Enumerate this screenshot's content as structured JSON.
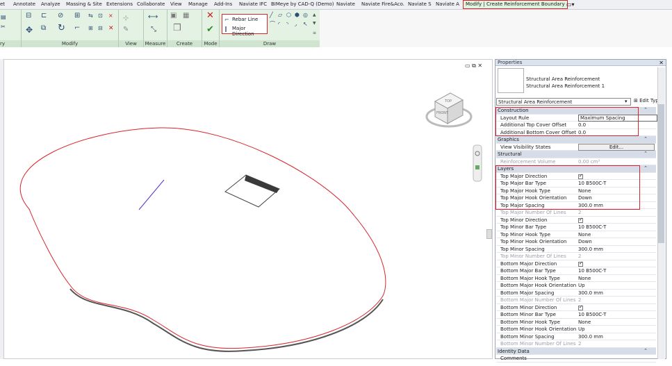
{
  "menu": {
    "tabs": [
      "et",
      "Annotate",
      "Analyze",
      "Massing & Site",
      "Extensions",
      "Collaborate",
      "View",
      "Manage",
      "Add-Ins",
      "Naviate IFC",
      "BIMeye by CAD-Q (Demo)",
      "Naviate",
      "Naviate Fire&Aco.",
      "Naviate S",
      "Naviate A"
    ],
    "active_tab": "Modify | Create Reinforcement Boundary"
  },
  "ribbon": {
    "groups": [
      "ry",
      "Modify",
      "View",
      "Measure",
      "Create",
      "Mode",
      "Draw"
    ],
    "draw_options": [
      "Rebar Line",
      "Major Direction"
    ]
  },
  "properties": {
    "title": "Properties",
    "type_name_1": "Structural Area Reinforcement",
    "type_name_2": "Structural Area Reinforcement 1",
    "selector": "Structural Area Reinforcement",
    "edit_type": "Edit Type",
    "rows": [
      {
        "kind": "sec",
        "label": "Construction"
      },
      {
        "label": "Layout Rule",
        "value": "Maximum Spacing",
        "box": true
      },
      {
        "label": "Additional Top Cover Offset",
        "value": "0.0"
      },
      {
        "label": "Additional Bottom Cover Offset",
        "value": "0.0"
      },
      {
        "kind": "sec",
        "label": "Graphics"
      },
      {
        "label": "View Visibility States",
        "value": "Edit...",
        "button": true
      },
      {
        "kind": "sec",
        "label": "Structural"
      },
      {
        "label": "Reinforcement Volume",
        "value": "0.00 cm³",
        "dim": true
      },
      {
        "kind": "sec",
        "label": "Layers"
      },
      {
        "label": "Top Major Direction",
        "check": true
      },
      {
        "label": "Top Major Bar Type",
        "value": "10 B500C-T"
      },
      {
        "label": "Top Major Hook Type",
        "value": "None"
      },
      {
        "label": "Top Major Hook Orientation",
        "value": "Down"
      },
      {
        "label": "Top Major Spacing",
        "value": "300.0 mm"
      },
      {
        "label": "Top Major Number Of Lines",
        "value": "2",
        "dim": true
      },
      {
        "label": "Top Minor Direction",
        "check": true
      },
      {
        "label": "Top Minor Bar Type",
        "value": "10 B500C-T"
      },
      {
        "label": "Top Minor Hook Type",
        "value": "None"
      },
      {
        "label": "Top Minor Hook Orientation",
        "value": "Down"
      },
      {
        "label": "Top Minor Spacing",
        "value": "300.0 mm"
      },
      {
        "label": "Top Minor Number Of Lines",
        "value": "2",
        "dim": true
      },
      {
        "label": "Bottom Major Direction",
        "check": true
      },
      {
        "label": "Bottom Major Bar Type",
        "value": "10 B500C-T"
      },
      {
        "label": "Bottom Major Hook Type",
        "value": "None"
      },
      {
        "label": "Bottom Major Hook Orientation",
        "value": "Up"
      },
      {
        "label": "Bottom Major Spacing",
        "value": "300.0 mm"
      },
      {
        "label": "Bottom Major Number Of Lines",
        "value": "2",
        "dim": true
      },
      {
        "label": "Bottom Minor Direction",
        "check": true
      },
      {
        "label": "Bottom Minor Bar Type",
        "value": "10 B500C-T"
      },
      {
        "label": "Bottom Minor Hook Type",
        "value": "None"
      },
      {
        "label": "Bottom Minor Hook Orientation",
        "value": "Up"
      },
      {
        "label": "Bottom Minor Spacing",
        "value": "300.0 mm"
      },
      {
        "label": "Bottom Minor Number Of Lines",
        "value": "2",
        "dim": true
      },
      {
        "kind": "sec",
        "label": "Identity Data"
      },
      {
        "label": "Comments",
        "value": ""
      }
    ]
  },
  "viewcube": {
    "top": "TOP",
    "front": "FRONT"
  },
  "colors": {
    "highlight": "#d9232a",
    "ribbon": "#e4f2e4",
    "boundary": "#d9232a"
  }
}
